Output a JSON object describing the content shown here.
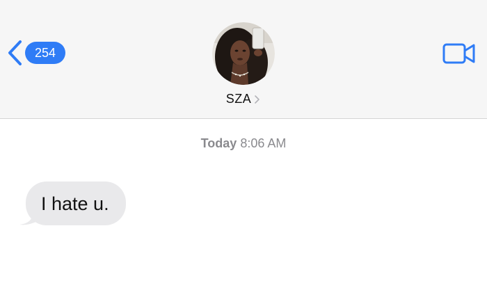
{
  "header": {
    "back_badge": "254",
    "contact_name": "SZA",
    "icons": {
      "back": "chevron-left-icon",
      "video": "video-camera-icon",
      "name_chevron": "chevron-right-icon"
    }
  },
  "conversation": {
    "timestamp_day": "Today",
    "timestamp_time": "8:06 AM",
    "messages": [
      {
        "direction": "incoming",
        "text": "I hate u."
      }
    ]
  },
  "colors": {
    "accent": "#2f7cf6",
    "header_bg": "#f6f6f6",
    "incoming_bubble": "#e9e9eb",
    "timestamp": "#8a8a8e"
  }
}
